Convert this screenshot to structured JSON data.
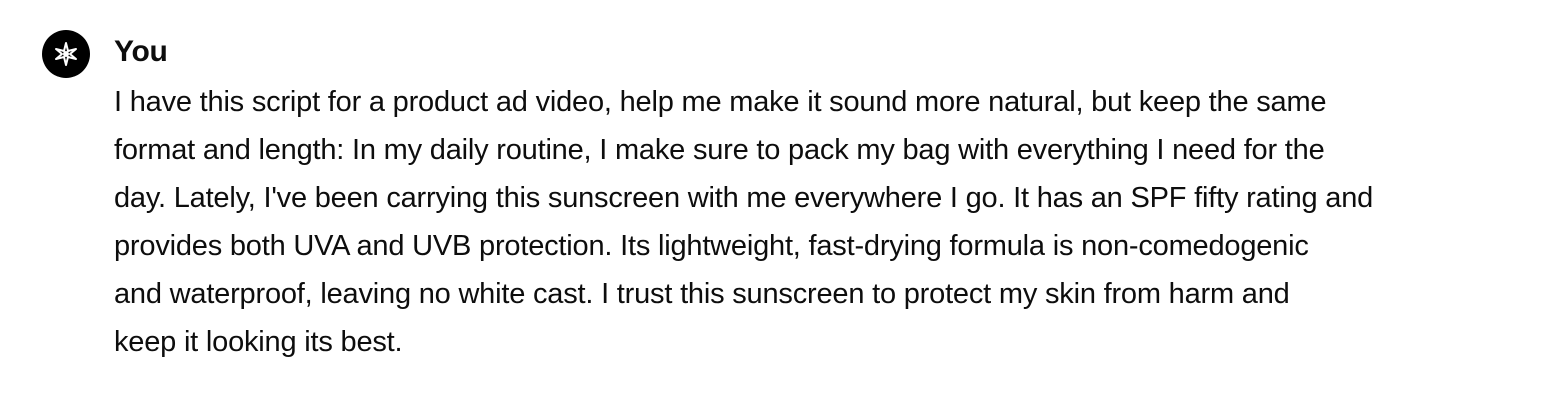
{
  "message": {
    "author": "You",
    "avatar_icon": "user-avatar-icon",
    "avatar_color": "#000000",
    "text": "I have this script for a product ad video, help me make it sound more natural, but keep the same\nformat and length: In my daily routine, I make sure to pack my bag with everything I need for the\nday. Lately, I've been carrying this sunscreen with me everywhere I go. It has an SPF fifty rating and\nprovides both UVA and UVB protection. Its lightweight, fast-drying formula is non-comedogenic\nand waterproof, leaving no white cast. I trust this sunscreen to protect my skin from harm and\nkeep it looking its best."
  }
}
